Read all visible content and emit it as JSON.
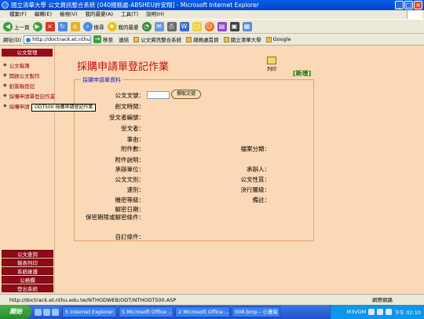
{
  "window": {
    "title": "國立清華大學 公文資訊整合系統 [040總務處-ABSHEU許安翔] - Microsoft Internet Explorer"
  },
  "menu": [
    "檔案(F)",
    "編輯(E)",
    "檢視(V)",
    "我的最愛(A)",
    "工具(T)",
    "說明(H)"
  ],
  "toolbar": {
    "back": "上一頁",
    "search": "搜尋",
    "favorites": "我的最愛"
  },
  "address": {
    "label": "網址(D)",
    "url": "http://doctrack.et.nthu.edu.tw/",
    "go": "移至",
    "links_label": "連結"
  },
  "links": [
    "公文資訊整合系統",
    "總務處首頁",
    "國立清華大學",
    "Google"
  ],
  "sidebar": {
    "header": "公文管理",
    "items": [
      {
        "label": "公文稿簿"
      },
      {
        "label": "開啟公文製作"
      },
      {
        "label": "創簽稿登記"
      },
      {
        "label": "採購申請單登記作業"
      },
      {
        "label": "採購申請"
      }
    ],
    "bottom": [
      "公文查詢",
      "報表列印",
      "系統維護",
      "公務欄",
      "登出系統"
    ]
  },
  "tooltip": "ODT500  採購申請登記作業",
  "page": {
    "title": "採購申請單登記作業",
    "print": "列印",
    "new": "[新增]",
    "section": "採購申請單資料",
    "fetch_button": "擷取文號",
    "fields_left": [
      "公文文號：",
      "創文時間：",
      "受文者編號：",
      "受文者：",
      "事由：",
      "附件數：",
      "附件說明：",
      "承辦單位：",
      "公文文別：",
      "速別：",
      "機密等級：",
      "解密日期：",
      "保密期限或解密條件：",
      "自訂條件："
    ],
    "fields_right": [
      "檔案分類：",
      "承辦人：",
      "公文性質：",
      "決行層級：",
      "備註："
    ]
  },
  "status": {
    "url": "http://doctrack.et.nthu.edu.tw/NTHODWEB/ODT/NTHODT500.ASP",
    "zone": "網際網路"
  },
  "taskbar": {
    "start": "開始",
    "tasks": [
      "5 Internet Explorer",
      "5 Microsoft Office ...",
      "2 Microsoft Office ...",
      "008.bmp - 小畫家"
    ],
    "clock": "下午 02:10",
    "ime": "M3VDM"
  },
  "colors": {
    "page_bg": "#fcd9b6",
    "title_red": "#c01010",
    "nav_red": "#9a0a1a",
    "new_green": "#0a7a0a"
  }
}
